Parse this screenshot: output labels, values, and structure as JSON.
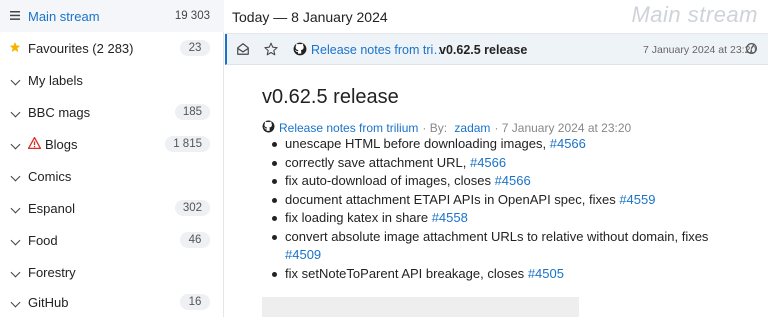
{
  "sidebar": {
    "items": [
      {
        "label": "Main stream",
        "count": "19 303",
        "lead": "menu",
        "icon": "menu-icon"
      },
      {
        "label": "Favourites (2 283)",
        "count": "23",
        "lead": "star",
        "icon": "star-icon"
      },
      {
        "label": "My labels",
        "count": "",
        "lead": "chevron",
        "icon": "chevron-down-icon"
      },
      {
        "label": "BBC mags",
        "count": "185",
        "lead": "chevron",
        "icon": "chevron-down-icon"
      },
      {
        "label": "Blogs",
        "count": "1 815",
        "lead": "chevron",
        "icon": "chevron-down-icon",
        "warn": true
      },
      {
        "label": "Comics",
        "count": "",
        "lead": "chevron",
        "icon": "chevron-down-icon"
      },
      {
        "label": "Espanol",
        "count": "302",
        "lead": "chevron",
        "icon": "chevron-down-icon"
      },
      {
        "label": "Food",
        "count": "46",
        "lead": "chevron",
        "icon": "chevron-down-icon"
      },
      {
        "label": "Forestry",
        "count": "",
        "lead": "chevron",
        "icon": "chevron-down-icon"
      },
      {
        "label": "GitHub",
        "count": "16",
        "lead": "chevron",
        "icon": "chevron-down-icon"
      }
    ]
  },
  "header": {
    "date": "Today — 8 January 2024",
    "watermark": "Main stream"
  },
  "article_row": {
    "source": "Release notes from tri…",
    "title": "v0.62.5 release",
    "date": "7 January 2024 at 23:20"
  },
  "article": {
    "title": "v0.62.5 release",
    "source": "Release notes from trilium",
    "byline_by": "· By: ",
    "author": "zadam",
    "byline_date": "· 7 January 2024 at 23:20",
    "items": [
      {
        "text": "unescape HTML before downloading images, ",
        "link": "#4566"
      },
      {
        "text": "correctly save attachment URL, ",
        "link": "#4566"
      },
      {
        "text": "fix auto-download of images, closes ",
        "link": "#4566"
      },
      {
        "text": "document attachment ETAPI APIs in OpenAPI spec, fixes ",
        "link": "#4559"
      },
      {
        "text": "fix loading katex in share ",
        "link": "#4558"
      },
      {
        "text": "convert absolute image attachment URLs to relative without domain, fixes ",
        "link": "#4509"
      },
      {
        "text": "fix setNoteToParent API breakage, closes ",
        "link": "#4505"
      }
    ]
  },
  "colors": {
    "accent": "#1a73c9",
    "warning": "#d93025",
    "star": "#f5b400"
  }
}
